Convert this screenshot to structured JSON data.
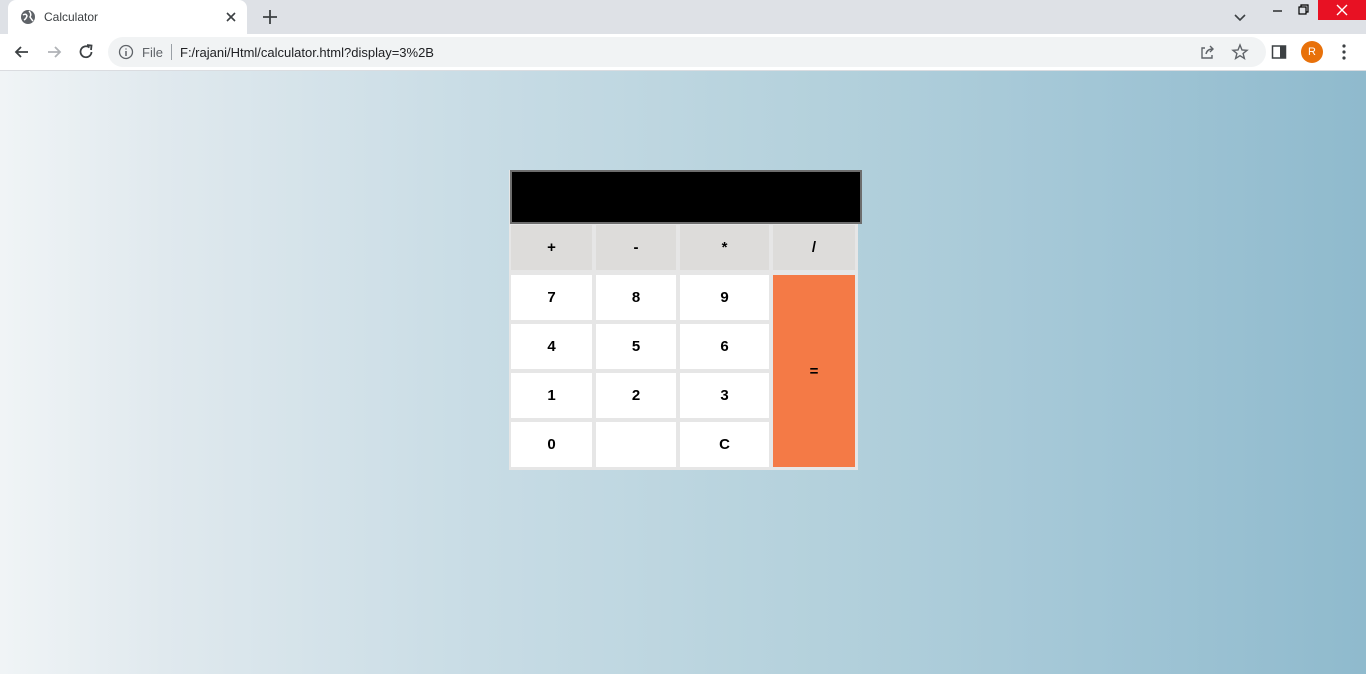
{
  "tab": {
    "title": "Calculator"
  },
  "address_bar": {
    "security_label": "File",
    "url": "F:/rajani/Html/calculator.html?display=3%2B"
  },
  "profile": {
    "initial": "R"
  },
  "calculator": {
    "display_value": "",
    "operator_keys": [
      "+",
      "-",
      "*",
      "/"
    ],
    "number_keys": [
      "7",
      "8",
      "9",
      "4",
      "5",
      "6",
      "1",
      "2",
      "3",
      "0",
      "",
      "C"
    ],
    "equals_label": "=",
    "colors": {
      "display": "#000000",
      "operator_key": "#dddcda",
      "equals_key": "#f47a46",
      "number_key": "#ffffff"
    }
  }
}
